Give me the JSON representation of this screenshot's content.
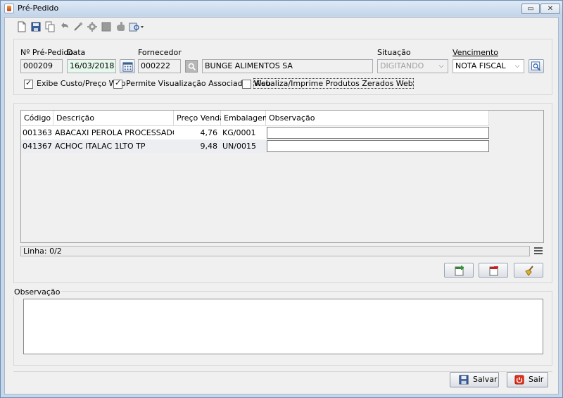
{
  "window": {
    "title": "Pré-Pedido"
  },
  "toolbar": {
    "icons": [
      "new-document-icon",
      "save-icon",
      "copy-icon",
      "undo-icon",
      "magic-wand-icon",
      "gear-icon",
      "stop-icon",
      "hand-icon",
      "print-preview-icon"
    ]
  },
  "header": {
    "numero_label": "Nº Pré-Pedido",
    "numero_value": "000209",
    "data_label": "Data",
    "data_value": "16/03/2018",
    "fornecedor_label": "Fornecedor",
    "fornecedor_code": "000222",
    "fornecedor_name": "BUNGE ALIMENTOS SA",
    "situacao_label": "Situação",
    "situacao_value": "DIGITANDO",
    "vencimento_label": "Vencimento",
    "vencimento_value": "NOTA FISCAL"
  },
  "checkboxes": {
    "exibe_custo": {
      "label": "Exibe Custo/Preço Web",
      "checked": true
    },
    "permite_visualizacao": {
      "label": "Permite Visualização Associados Web",
      "checked": true
    },
    "visualiza_zerados": {
      "label": "Visualiza/Imprime Produtos Zerados Web",
      "checked": false
    }
  },
  "grid": {
    "columns": [
      "Código",
      "Descrição",
      "Preço Venda",
      "Embalagem",
      "Observação"
    ],
    "rows": [
      {
        "codigo": "001363",
        "descricao": "ABACAXI PEROLA PROCESSADO KG",
        "preco": "4,76",
        "embalagem": "KG/0001",
        "observacao": ""
      },
      {
        "codigo": "041367",
        "descricao": "ACHOC ITALAC 1LTO TP",
        "preco": "9,48",
        "embalagem": "UN/0015",
        "observacao": ""
      }
    ],
    "status": "Linha: 0/2"
  },
  "observacao": {
    "label": "Observação",
    "value": ""
  },
  "buttons": {
    "salvar": "Salvar",
    "sair": "Sair"
  },
  "colors": {
    "window_frame": "#c6d7ea",
    "date_field": "#e6f7ec",
    "exit_red": "#e0301e"
  }
}
